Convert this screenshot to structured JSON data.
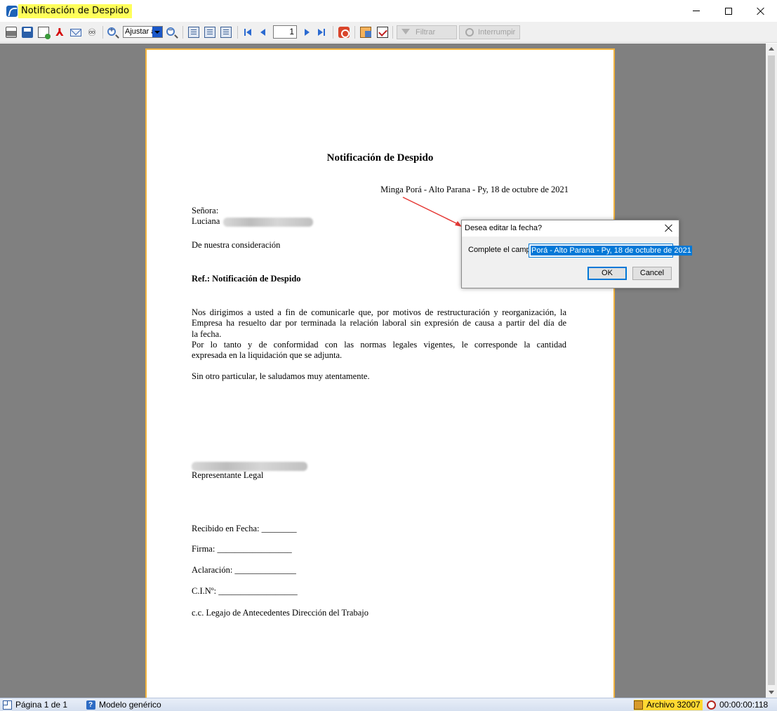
{
  "window": {
    "title": "Notificación de Despido"
  },
  "toolbar": {
    "zoom_value": "Ajustar a",
    "page_number": "1",
    "filter_label": "Filtrar",
    "interrupt_label": "Interrumpir",
    "icons": [
      "printer-icon",
      "save-icon",
      "export-icon",
      "pdf-icon",
      "mail-icon",
      "binoculars-icon",
      "zoom-in-icon",
      "zoom-out-icon",
      "one-page-icon",
      "two-page-icon",
      "page-setup-icon",
      "first-page-icon",
      "previous-page-icon",
      "next-page-icon",
      "last-page-icon",
      "stop-icon",
      "copy-icon",
      "check-icon",
      "funnel-icon",
      "interrupt-icon"
    ]
  },
  "document": {
    "title": "Notificación de Despido",
    "date_line": "Minga Porá - Alto Parana - Py, 18 de octubre de 2021",
    "salutation": "Señora:",
    "recipient_first_name": "Luciana",
    "greeting": "De nuestra consideración",
    "ref": "Ref.: Notificación de Despido",
    "body_lines": [
      "Nos dirigimos a usted a fin de comunicarle que, por motivos de restructuración y reorganización, la",
      "Empresa ha resuelto dar por terminada la relación laboral sin expresión de causa a partir del día de",
      "la fecha.",
      "Por lo tanto y de conformidad con las normas legales vigentes, le corresponde la cantidad",
      "expresada en la liquidación que se adjunta."
    ],
    "closing": "Sin otro particular, le saludamos muy atentamente.",
    "signer_role": "Representante Legal",
    "received_date": "Recibido en Fecha: ________",
    "signature": "Firma: _________________",
    "clarification": "Aclaración: ______________",
    "cin": "C.I.Nº: __________________",
    "cc": "c.c. Legajo de Antecedentes Dirección del Trabajo"
  },
  "dialog": {
    "title": "Desea editar la fecha?",
    "field_label": "Complete el campo",
    "field_value": "Porá - Alto Parana - Py, 18 de octubre de 2021",
    "ok_label": "OK",
    "cancel_label": "Cancel"
  },
  "statusbar": {
    "page_info": "Página 1 de 1",
    "model": "Modelo genérico",
    "archive": "Archivo 32007",
    "elapsed": "00:00:00:118"
  },
  "colors": {
    "title_highlight": "#ffff5a",
    "page_border": "#f2b33d",
    "selection": "#0078d7",
    "annotation_arrow": "#e53935",
    "archive_highlight": "#ffd932"
  }
}
